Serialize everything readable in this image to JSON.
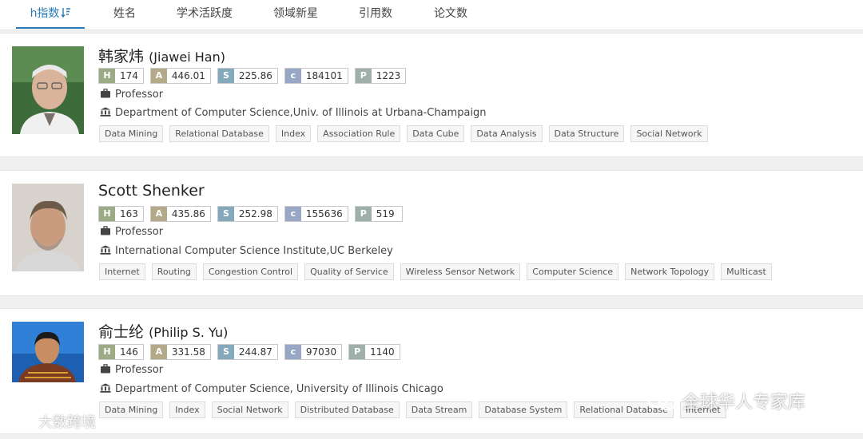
{
  "tabs": [
    {
      "label": "h指数",
      "active": true,
      "icon": "sort-descending-icon"
    },
    {
      "label": "姓名"
    },
    {
      "label": "学术活跃度"
    },
    {
      "label": "领域新星"
    },
    {
      "label": "引用数"
    },
    {
      "label": "论文数"
    }
  ],
  "stat_keys": {
    "h": "H",
    "a": "A",
    "s": "S",
    "c": "c",
    "p": "P"
  },
  "scholars": [
    {
      "name_cn": "韩家炜",
      "name_en": "(Jiawei Han)",
      "stats": {
        "h": "174",
        "a": "446.01",
        "s": "225.86",
        "c": "184101",
        "p": "1223"
      },
      "position": "Professor",
      "affiliation": "Department of Computer Science,Univ. of Illinois at Urbana-Champaign",
      "tags": [
        "Data Mining",
        "Relational Database",
        "Index",
        "Association Rule",
        "Data Cube",
        "Data Analysis",
        "Data Structure",
        "Social Network"
      ]
    },
    {
      "name_cn": "",
      "name_en": "Scott Shenker",
      "stats": {
        "h": "163",
        "a": "435.86",
        "s": "252.98",
        "c": "155636",
        "p": "519"
      },
      "position": "Professor",
      "affiliation": "International Computer Science Institute,UC Berkeley",
      "tags": [
        "Internet",
        "Routing",
        "Congestion Control",
        "Quality of Service",
        "Wireless Sensor Network",
        "Computer Science",
        "Network Topology",
        "Multicast"
      ]
    },
    {
      "name_cn": "俞士纶",
      "name_en": "(Philip S. Yu)",
      "stats": {
        "h": "146",
        "a": "331.58",
        "s": "244.87",
        "c": "97030",
        "p": "1140"
      },
      "position": "Professor",
      "affiliation": "Department of Computer Science, University of Illinois Chicago",
      "tags": [
        "Data Mining",
        "Index",
        "Social Network",
        "Distributed Database",
        "Data Stream",
        "Database System",
        "Relational Database",
        "Internet"
      ]
    }
  ],
  "watermarks": {
    "left": "大数跨境",
    "right": "全球华人专家库"
  }
}
